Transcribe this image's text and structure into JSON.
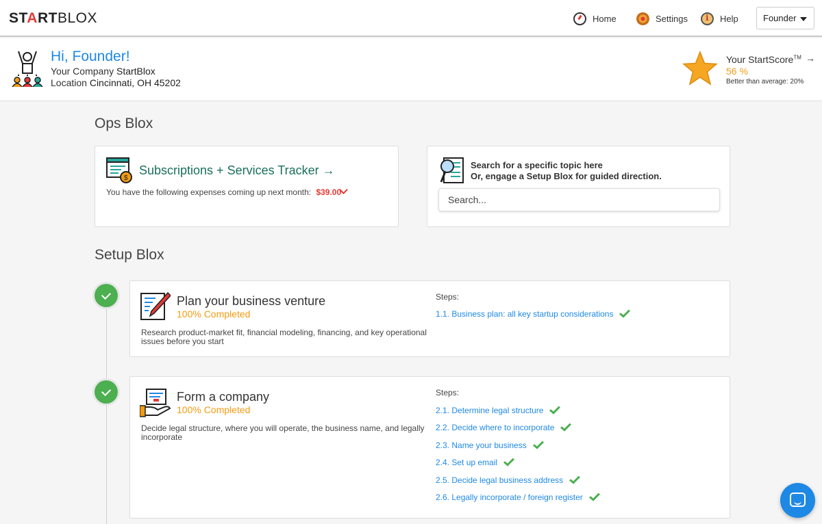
{
  "topnav": {
    "logo": {
      "part1": "ST",
      "accent": "A",
      "part2": "RT",
      "part3": "BLOX"
    },
    "links": [
      {
        "label": "Home",
        "icon": "home-icon"
      },
      {
        "label": "Settings",
        "icon": "settings-icon"
      },
      {
        "label": "Help",
        "icon": "help-icon"
      }
    ],
    "user_menu": {
      "label": "Founder"
    }
  },
  "profile": {
    "greeting": "Hi, Founder!",
    "company_label": "Your Company",
    "company": "StartBlox",
    "location_label": "Location",
    "location": "Cincinnati, OH 45202",
    "score_label": "Your StartScore",
    "score_tm": "TM",
    "score_arrow": "→",
    "score_value": "56 %",
    "score_avg": "Better than average: 20%"
  },
  "ops": {
    "heading": "Ops Blox",
    "tracker": {
      "title": "Subscriptions + Services Tracker →",
      "text": "You have the following expenses coming up next month:",
      "amount": "$39.00"
    },
    "search": {
      "line1": "Search for a specific topic here",
      "line2": "Or, engage a Setup Blox for guided direction.",
      "placeholder": "Search..."
    }
  },
  "setup": {
    "heading": "Setup Blox",
    "steps_label": "Steps:",
    "blox": [
      {
        "title": "Plan your business venture",
        "progress": "100% Completed",
        "description": "Research product-market fit, financial modeling, financing, and key operational issues before you start",
        "steps": [
          "1.1. Business plan: all key startup considerations"
        ]
      },
      {
        "title": "Form a company",
        "progress": "100% Completed",
        "description": "Decide legal structure, where you will operate, the business name, and legally incorporate",
        "steps": [
          "2.1. Determine legal structure",
          "2.2. Decide where to incorporate",
          "2.3. Name your business",
          "2.4. Set up email",
          "2.5. Decide legal business address",
          "2.6. Legally incorporate / foreign register"
        ]
      }
    ]
  },
  "colors": {
    "brand_blue": "#1e88e5",
    "accent_orange": "#f39c12",
    "success_green": "#4caf50",
    "alert_red": "#e53935"
  }
}
